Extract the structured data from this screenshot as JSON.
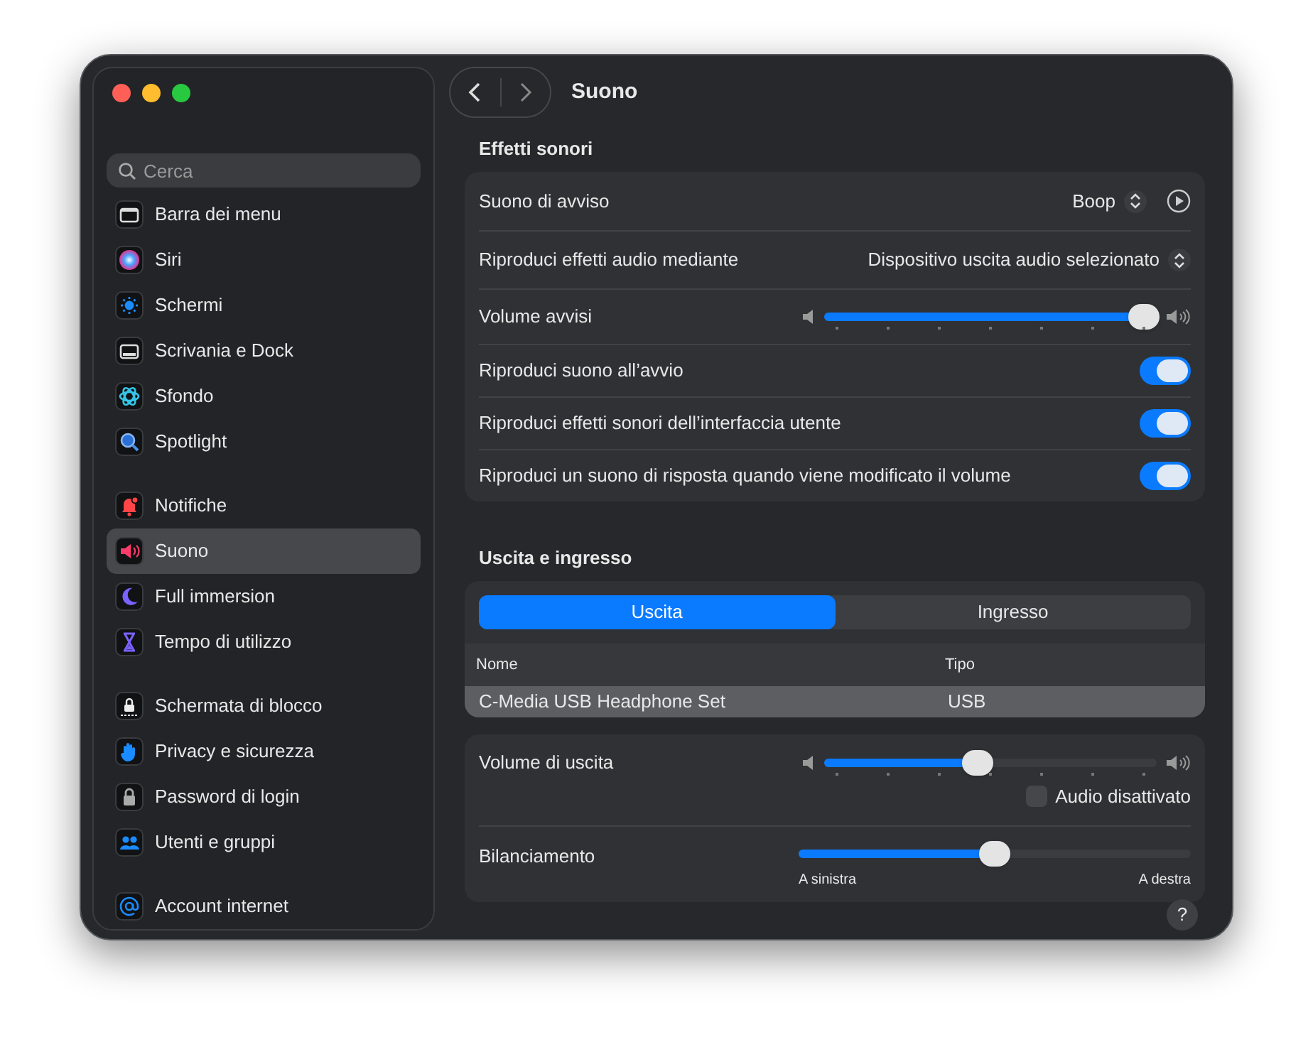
{
  "sidebar": {
    "search": {
      "placeholder": "Cerca"
    },
    "groups": [
      [
        {
          "label": "Barra dei menu",
          "selected": false
        },
        {
          "label": "Siri",
          "selected": false
        },
        {
          "label": "Schermi",
          "selected": false
        },
        {
          "label": "Scrivania e Dock",
          "selected": false
        },
        {
          "label": "Sfondo",
          "selected": false
        },
        {
          "label": "Spotlight",
          "selected": false
        }
      ],
      [
        {
          "label": "Notifiche",
          "selected": false
        },
        {
          "label": "Suono",
          "selected": true
        },
        {
          "label": "Full immersion",
          "selected": false
        },
        {
          "label": "Tempo di utilizzo",
          "selected": false
        }
      ],
      [
        {
          "label": "Schermata di blocco",
          "selected": false
        },
        {
          "label": "Privacy e sicurezza",
          "selected": false
        },
        {
          "label": "Password di login",
          "selected": false
        },
        {
          "label": "Utenti e gruppi",
          "selected": false
        }
      ],
      [
        {
          "label": "Account internet",
          "selected": false
        }
      ]
    ]
  },
  "title": "Suono",
  "sound_effects": {
    "heading": "Effetti sonori",
    "rows": [
      {
        "kind": "popup",
        "label": "Suono di avviso",
        "value": "Boop",
        "play": true
      },
      {
        "kind": "popup",
        "label": "Riproduci effetti audio mediante",
        "value": "Dispositivo uscita audio selezionato",
        "play": false
      },
      {
        "kind": "slider",
        "label": "Volume avvisi",
        "level": 0.96
      },
      {
        "kind": "toggle",
        "label": "Riproduci suono all’avvio",
        "on": true
      },
      {
        "kind": "toggle",
        "label": "Riproduci effetti sonori dell’interfaccia utente",
        "on": true
      },
      {
        "kind": "toggle",
        "label": "Riproduci un suono di risposta quando viene modificato il volume",
        "on": true
      }
    ]
  },
  "output_input": {
    "heading": "Uscita e ingresso",
    "tabs": [
      {
        "label": "Uscita",
        "selected": true
      },
      {
        "label": "Ingresso",
        "selected": false
      }
    ],
    "table": {
      "columns": [
        "Nome",
        "Tipo"
      ],
      "rows": [
        {
          "cells": [
            "C-Media USB Headphone Set",
            "USB"
          ],
          "selected": true
        }
      ]
    },
    "output_volume": {
      "label": "Volume di uscita",
      "level": 0.46
    },
    "mute": {
      "label": "Audio disattivato",
      "checked": false
    },
    "balance": {
      "label": "Bilanciamento",
      "level": 0.5,
      "left_label": "A sinistra",
      "right_label": "A destra"
    }
  },
  "help": "?"
}
